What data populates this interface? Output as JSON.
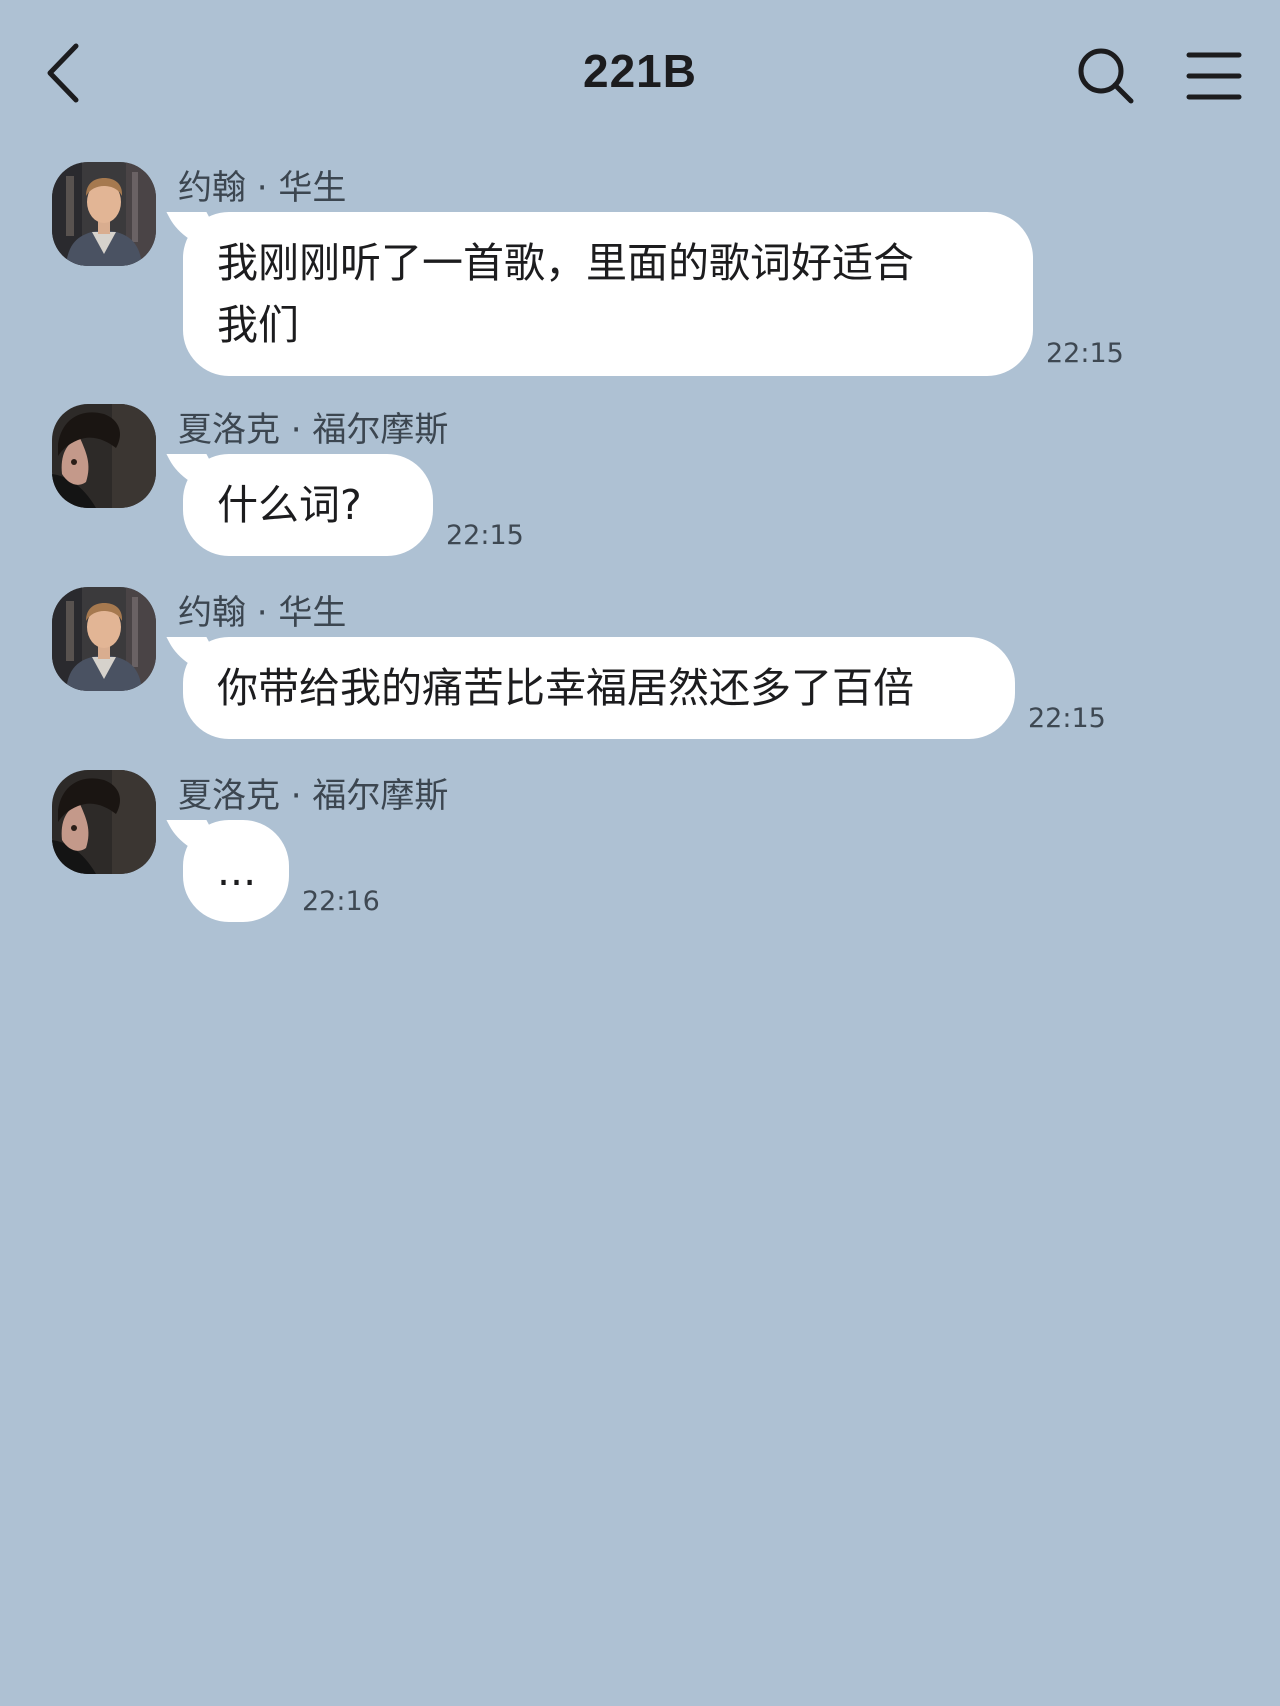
{
  "header": {
    "title": "221B",
    "back_icon": "back-chevron-icon",
    "search_icon": "search-icon",
    "menu_icon": "menu-icon"
  },
  "colors": {
    "background": "#aec1d3",
    "bubble": "#ffffff",
    "text": "#1c1c1e",
    "meta": "#3e4852"
  },
  "messages": [
    {
      "sender": "约翰 · 华生",
      "avatar": "avatar-john-watson",
      "text": "我刚刚听了一首歌，里面的歌词好适合\n我们",
      "time": "22:15"
    },
    {
      "sender": "夏洛克 · 福尔摩斯",
      "avatar": "avatar-sherlock-holmes",
      "text": "什么词?",
      "time": "22:15"
    },
    {
      "sender": "约翰 · 华生",
      "avatar": "avatar-john-watson",
      "text": "你带给我的痛苦比幸福居然还多了百倍",
      "time": "22:15"
    },
    {
      "sender": "夏洛克 · 福尔摩斯",
      "avatar": "avatar-sherlock-holmes",
      "text": "...",
      "time": "22:16"
    }
  ]
}
